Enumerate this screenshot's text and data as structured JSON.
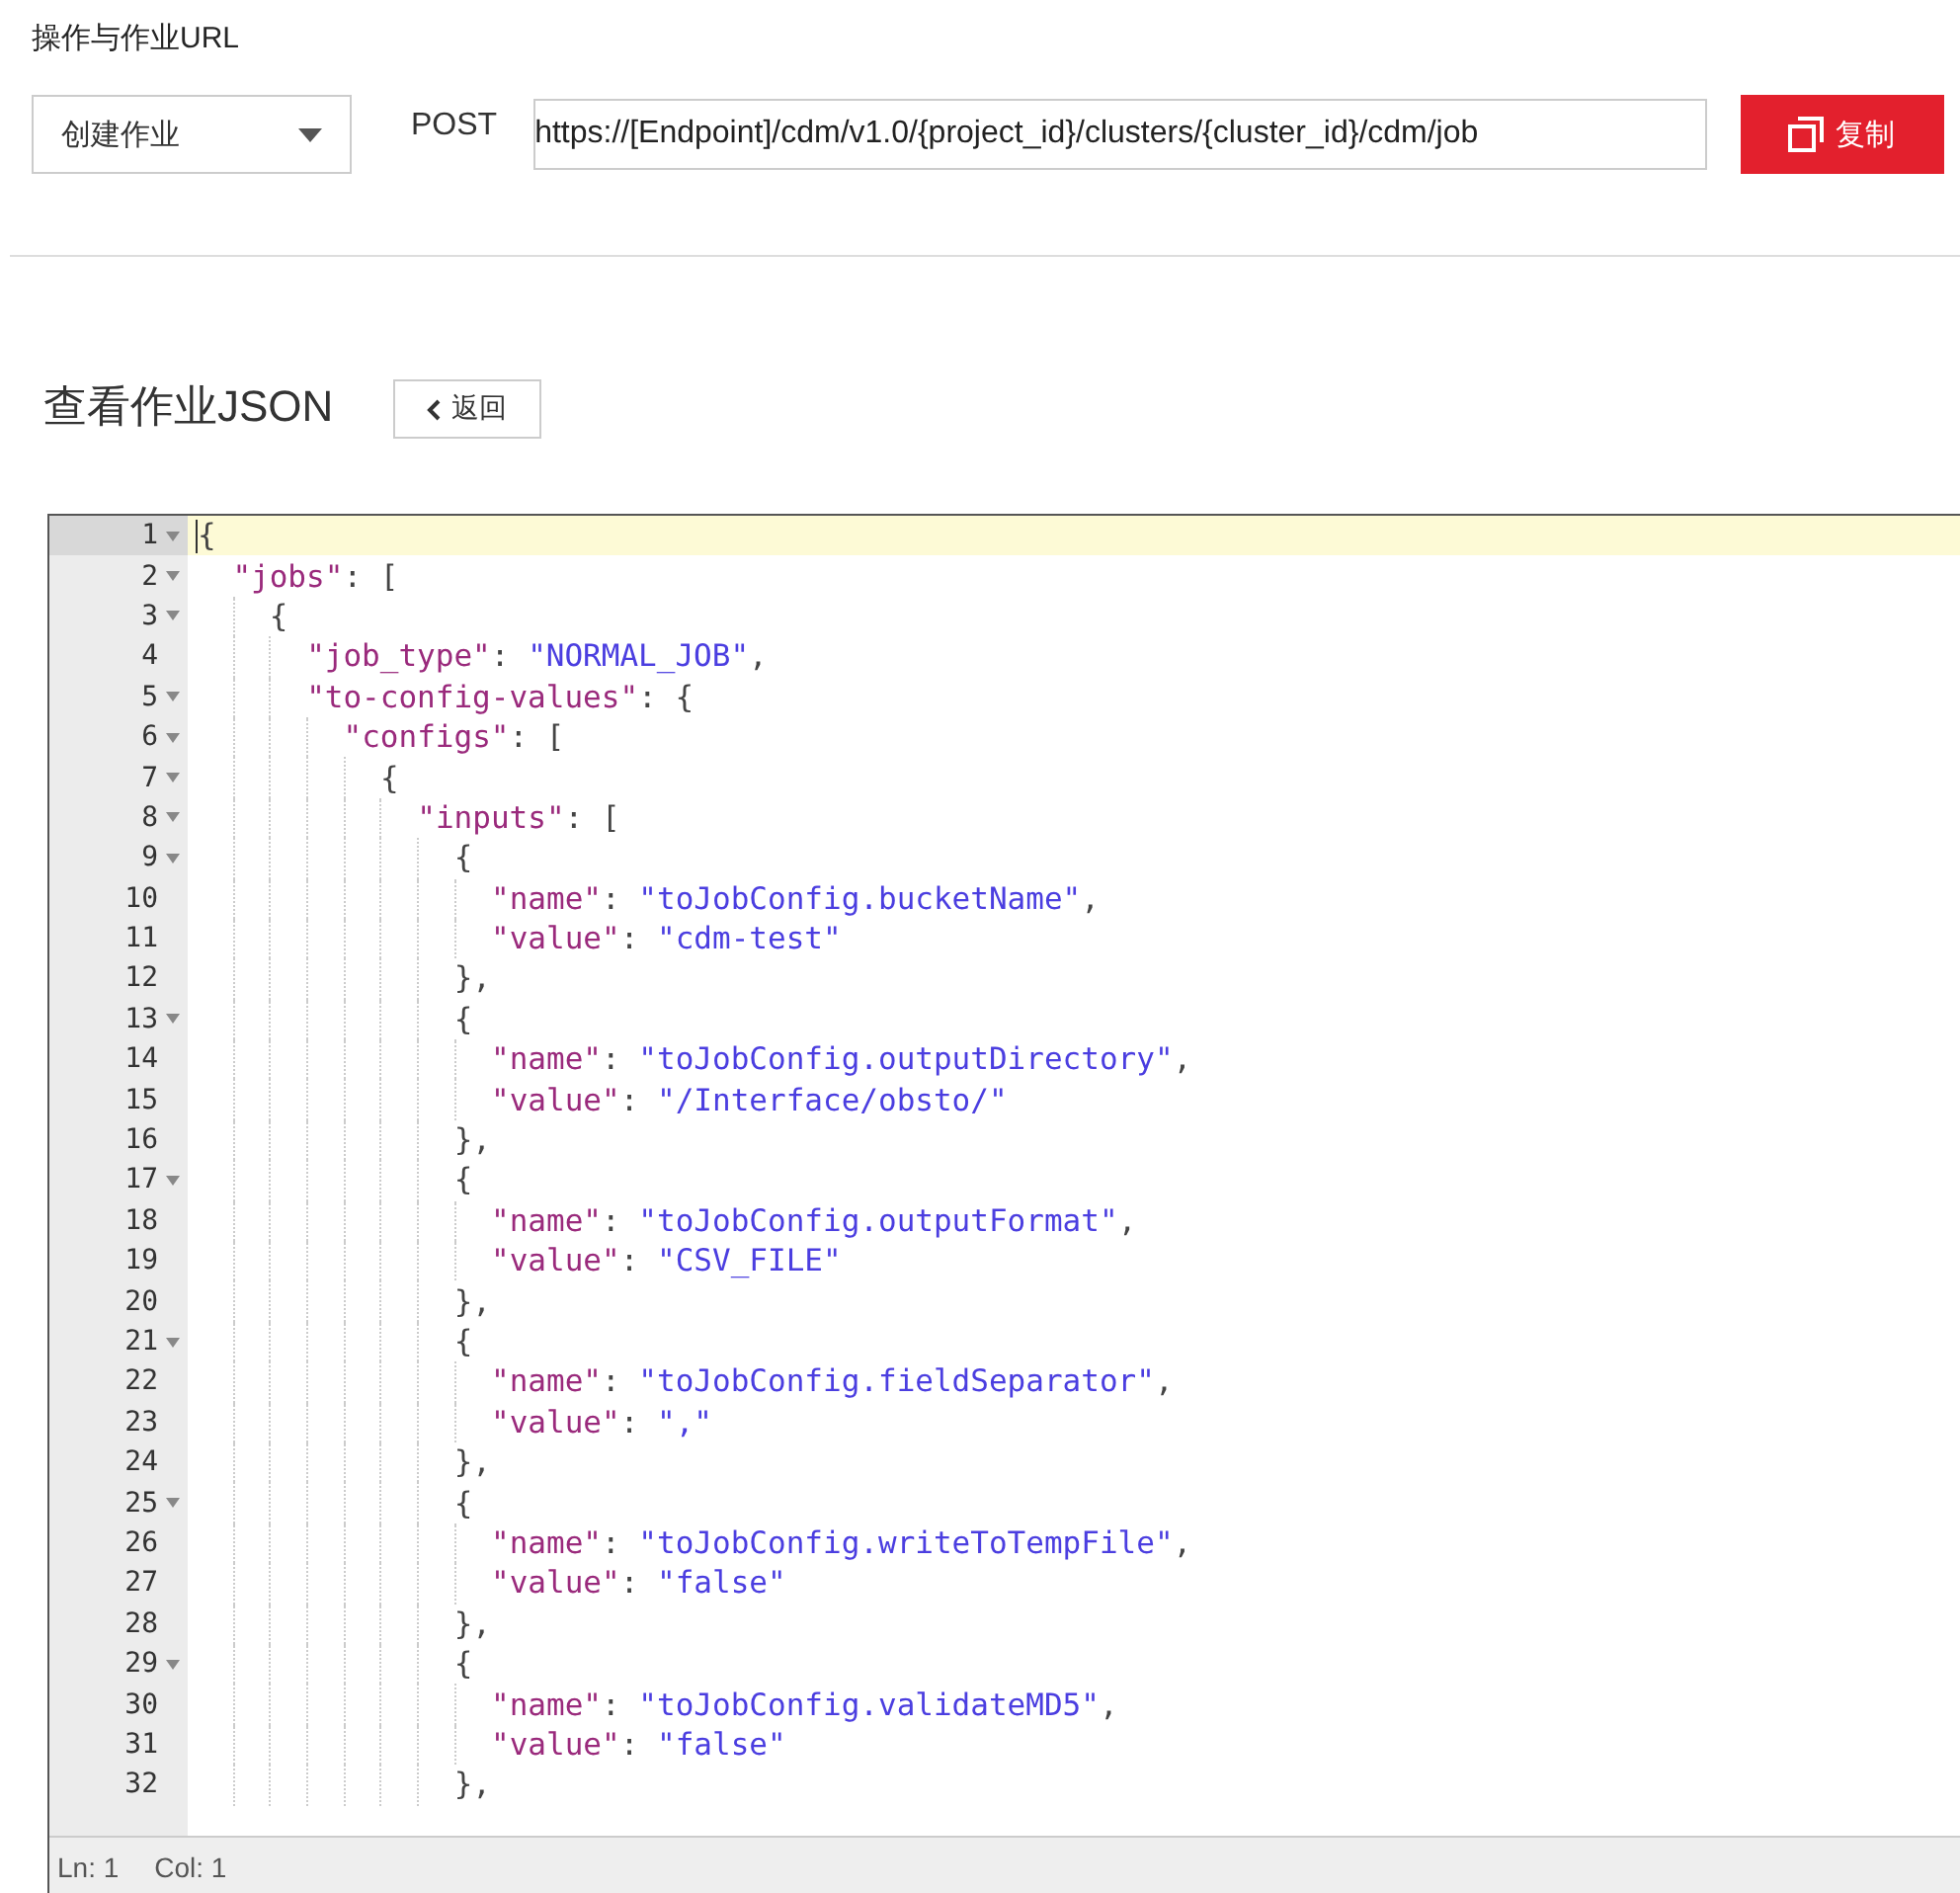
{
  "url_section": {
    "title": "操作与作业URL",
    "operation": {
      "value": "创建作业"
    },
    "method": "POST",
    "url": "https://[Endpoint]/cdm/v1.0/{project_id}/clusters/{cluster_id}/cdm/job",
    "copy_button": "复制"
  },
  "json_section": {
    "title": "查看作业JSON",
    "back_button": "返回"
  },
  "editor": {
    "lines": [
      {
        "number": "1",
        "fold": true,
        "active": true,
        "text": "{"
      },
      {
        "number": "2",
        "fold": true,
        "active": false,
        "text": "  \"jobs\": ["
      },
      {
        "number": "3",
        "fold": true,
        "active": false,
        "text": "    {"
      },
      {
        "number": "4",
        "fold": false,
        "active": false,
        "text": "      \"job_type\": \"NORMAL_JOB\","
      },
      {
        "number": "5",
        "fold": true,
        "active": false,
        "text": "      \"to-config-values\": {"
      },
      {
        "number": "6",
        "fold": true,
        "active": false,
        "text": "        \"configs\": ["
      },
      {
        "number": "7",
        "fold": true,
        "active": false,
        "text": "          {"
      },
      {
        "number": "8",
        "fold": true,
        "active": false,
        "text": "            \"inputs\": ["
      },
      {
        "number": "9",
        "fold": true,
        "active": false,
        "text": "              {"
      },
      {
        "number": "10",
        "fold": false,
        "active": false,
        "text": "                \"name\": \"toJobConfig.bucketName\","
      },
      {
        "number": "11",
        "fold": false,
        "active": false,
        "text": "                \"value\": \"cdm-test\""
      },
      {
        "number": "12",
        "fold": false,
        "active": false,
        "text": "              },"
      },
      {
        "number": "13",
        "fold": true,
        "active": false,
        "text": "              {"
      },
      {
        "number": "14",
        "fold": false,
        "active": false,
        "text": "                \"name\": \"toJobConfig.outputDirectory\","
      },
      {
        "number": "15",
        "fold": false,
        "active": false,
        "text": "                \"value\": \"/Interface/obsto/\""
      },
      {
        "number": "16",
        "fold": false,
        "active": false,
        "text": "              },"
      },
      {
        "number": "17",
        "fold": true,
        "active": false,
        "text": "              {"
      },
      {
        "number": "18",
        "fold": false,
        "active": false,
        "text": "                \"name\": \"toJobConfig.outputFormat\","
      },
      {
        "number": "19",
        "fold": false,
        "active": false,
        "text": "                \"value\": \"CSV_FILE\""
      },
      {
        "number": "20",
        "fold": false,
        "active": false,
        "text": "              },"
      },
      {
        "number": "21",
        "fold": true,
        "active": false,
        "text": "              {"
      },
      {
        "number": "22",
        "fold": false,
        "active": false,
        "text": "                \"name\": \"toJobConfig.fieldSeparator\","
      },
      {
        "number": "23",
        "fold": false,
        "active": false,
        "text": "                \"value\": \",\""
      },
      {
        "number": "24",
        "fold": false,
        "active": false,
        "text": "              },"
      },
      {
        "number": "25",
        "fold": true,
        "active": false,
        "text": "              {"
      },
      {
        "number": "26",
        "fold": false,
        "active": false,
        "text": "                \"name\": \"toJobConfig.writeToTempFile\","
      },
      {
        "number": "27",
        "fold": false,
        "active": false,
        "text": "                \"value\": \"false\""
      },
      {
        "number": "28",
        "fold": false,
        "active": false,
        "text": "              },"
      },
      {
        "number": "29",
        "fold": true,
        "active": false,
        "text": "              {"
      },
      {
        "number": "30",
        "fold": false,
        "active": false,
        "text": "                \"name\": \"toJobConfig.validateMD5\","
      },
      {
        "number": "31",
        "fold": false,
        "active": false,
        "text": "                \"value\": \"false\""
      },
      {
        "number": "32",
        "fold": false,
        "active": false,
        "text": "              },"
      }
    ],
    "status": {
      "line": "Ln: 1",
      "column": "Col: 1"
    }
  }
}
